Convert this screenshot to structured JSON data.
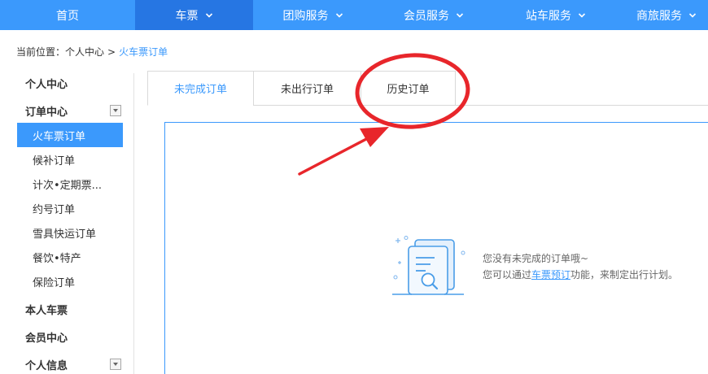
{
  "nav": {
    "items": [
      {
        "label": "首页"
      },
      {
        "label": "车票"
      },
      {
        "label": "团购服务"
      },
      {
        "label": "会员服务"
      },
      {
        "label": "站车服务"
      },
      {
        "label": "商旅服务"
      }
    ]
  },
  "breadcrumb": {
    "prefix": "当前位置：",
    "crumb1": "个人中心",
    "separator": ">",
    "current": "火车票订单"
  },
  "sidebar": {
    "personal_center": "个人中心",
    "order_center": "订单中心",
    "orders": [
      {
        "label": "火车票订单"
      },
      {
        "label": "候补订单"
      },
      {
        "label": "计次•定期票..."
      },
      {
        "label": "约号订单"
      },
      {
        "label": "雪具快运订单"
      },
      {
        "label": "餐饮•特产"
      },
      {
        "label": "保险订单"
      }
    ],
    "my_tickets": "本人车票",
    "member_center": "会员中心",
    "personal_info": "个人信息"
  },
  "tabs": [
    {
      "label": "未完成订单"
    },
    {
      "label": "未出行订单"
    },
    {
      "label": "历史订单"
    }
  ],
  "empty": {
    "line1": "您没有未完成的订单哦~",
    "line2_prefix": "您可以通过",
    "line2_link": "车票预订",
    "line2_suffix": "功能，来制定出行计划。"
  },
  "colors": {
    "primary": "#3b99fc",
    "nav_active": "#2676e3",
    "annotation": "#e8262b"
  },
  "icons": {
    "chevron": "chevron-down-icon",
    "toggle": "collapse-toggle-icon",
    "empty": "empty-document-search-icon",
    "annotation_circle": "annotation-circle",
    "annotation_arrow": "annotation-arrow"
  }
}
